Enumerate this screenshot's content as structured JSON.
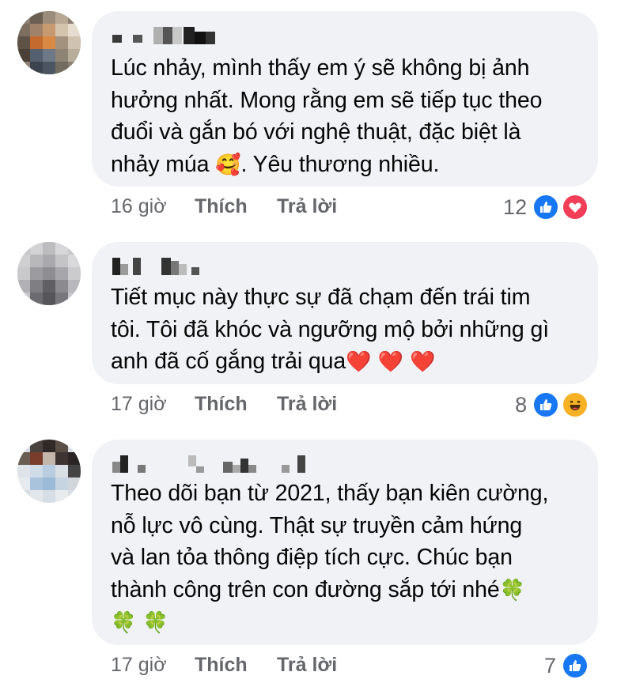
{
  "comments": [
    {
      "text": "Lúc nhảy, mình thấy em ý sẽ không bị ảnh\nhưởng nhất. Mong rằng em sẽ tiếp tục theo\nđuổi và gắn bó với nghệ thuật, đặc biệt là\nnhảy múa ",
      "text_tail": ". Yêu thương nhiều.",
      "emoji": "🥰",
      "time": "16 giờ",
      "like_label": "Thích",
      "reply_label": "Trả lời",
      "reaction_count": "12",
      "reactions": [
        "like-icon",
        "love-icon"
      ]
    },
    {
      "text": "Tiết mục này thực sự đã chạm đến trái tim\ntôi. Tôi đã khóc và ngưỡng mộ bởi những gì\nanh đã cố gắng trải qua",
      "emoji": "❤️ ❤️ ❤️",
      "time": "17 giờ",
      "like_label": "Thích",
      "reply_label": "Trả lời",
      "reaction_count": "8",
      "reactions": [
        "like-icon",
        "haha-icon"
      ]
    },
    {
      "text": "Theo dõi bạn từ 2021, thấy bạn kiên cường,\nnỗ lực vô cùng. Thật sự truyền cảm hứng\nvà lan tỏa thông điệp tích cực. Chúc bạn\nthành công trên con đường sắp tới nhé",
      "emoji": "🍀",
      "emoji_line2": "🍀 🍀",
      "time": "17 giờ",
      "like_label": "Thích",
      "reply_label": "Trả lời",
      "reaction_count": "7",
      "reactions": [
        "like-icon"
      ]
    }
  ],
  "colors": {
    "bubble": "#f0f2f5",
    "meta_text": "#65676b",
    "like_blue": "#1877f2",
    "love_red": "#f33e58",
    "haha_yellow": "#f7b125"
  }
}
